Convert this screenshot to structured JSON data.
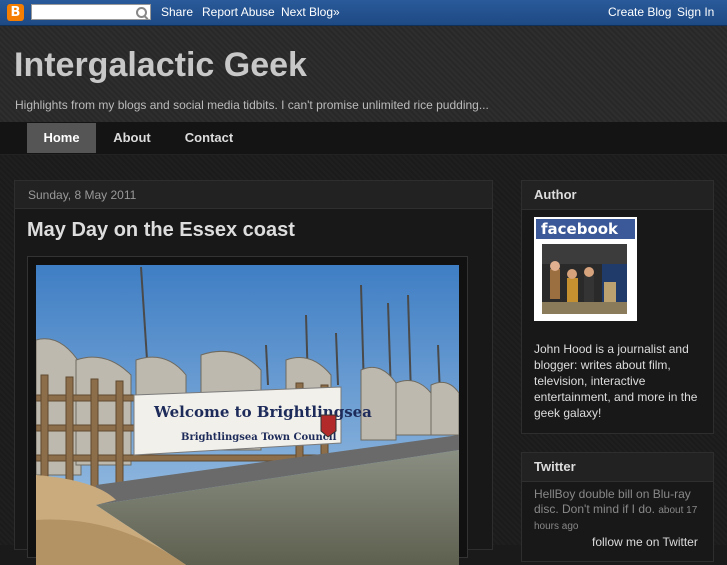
{
  "navbar": {
    "logo_letter": "B",
    "search_placeholder": "",
    "share": "Share",
    "report_abuse": "Report Abuse",
    "next_blog": "Next Blog»",
    "create_blog": "Create Blog",
    "sign_in": "Sign In"
  },
  "header": {
    "title": "Intergalactic Geek",
    "description": "Highlights from my blogs and social media tidbits. I can't promise unlimited rice pudding..."
  },
  "tabs": [
    {
      "label": "Home",
      "active": true
    },
    {
      "label": "About",
      "active": false
    },
    {
      "label": "Contact",
      "active": false
    }
  ],
  "post": {
    "date": "Sunday, 8 May 2011",
    "title": "May Day on the Essex coast",
    "sign_line1": "Welcome to Brightlingsea",
    "sign_line2": "Brightlingsea Town Council"
  },
  "sidebar": {
    "author": {
      "title": "Author",
      "badge_label": "facebook",
      "bio": "John Hood is a journalist and blogger: writes about film, television, interactive entertainment, and more in the geek galaxy!"
    },
    "twitter": {
      "title": "Twitter",
      "tweet": "HellBoy double bill on Blu-ray disc. Don't mind if I do.",
      "time": "about 17 hours ago",
      "follow": "follow me on Twitter"
    }
  },
  "colors": {
    "navbar": "#1e4a84",
    "background": "#1a1a1a",
    "facebook": "#3b5998",
    "blogger": "#f57d00"
  }
}
